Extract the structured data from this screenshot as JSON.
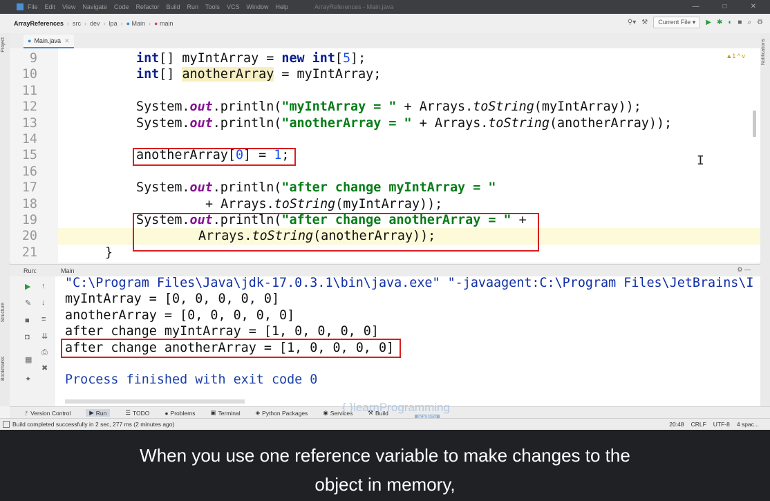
{
  "menu": {
    "items": [
      "File",
      "Edit",
      "View",
      "Navigate",
      "Code",
      "Refactor",
      "Build",
      "Run",
      "Tools",
      "VCS",
      "Window",
      "Help"
    ],
    "window_title": "ArrayReferences - Main.java"
  },
  "breadcrumb": {
    "project": "ArrayReferences",
    "parts": [
      "src",
      "dev",
      "lpa",
      "Main",
      "main"
    ]
  },
  "toolbar": {
    "run_config": "Current File ▾"
  },
  "side_labels": {
    "project": "Project",
    "structure": "Structure",
    "bookmarks": "Bookmarks",
    "notifications": "Notifications"
  },
  "editor_tab": {
    "label": "Main.java"
  },
  "warning_indicator": "▲1 ^ v",
  "code": {
    "line_numbers": [
      "9",
      "10",
      "11",
      "12",
      "13",
      "14",
      "15",
      "16",
      "17",
      "18",
      "19",
      "20",
      "21"
    ],
    "l9": {
      "a": "int",
      "b": "[] myIntArray = ",
      "c": "new",
      "d": " ",
      "e": "int",
      "f": "[",
      "g": "5",
      "h": "];"
    },
    "l10": {
      "a": "int",
      "b": "[] ",
      "c": "anotherArray",
      "d": " = myIntArray;"
    },
    "l12": {
      "a": "System.",
      "b": "out",
      "c": ".println(",
      "d": "\"myIntArray = \"",
      "e": " + Arrays.",
      "f": "toString",
      "g": "(myIntArray));"
    },
    "l13": {
      "a": "System.",
      "b": "out",
      "c": ".println(",
      "d": "\"anotherArray = \"",
      "e": " + Arrays.",
      "f": "toString",
      "g": "(anotherArray));"
    },
    "l15": {
      "a": "anotherArray[",
      "b": "0",
      "c": "] = ",
      "d": "1",
      "e": ";"
    },
    "l17": {
      "a": "System.",
      "b": "out",
      "c": ".println(",
      "d": "\"after change myIntArray = \""
    },
    "l18": {
      "a": "+ Arrays.",
      "b": "toString",
      "c": "(myIntArray));"
    },
    "l19": {
      "a": "System.",
      "b": "out",
      "c": ".println(",
      "d": "\"after change anotherArray = \"",
      "e": " +"
    },
    "l20": {
      "a": "Arrays.",
      "b": "toString",
      "c": "(anotherArray));"
    },
    "l21": {
      "a": "}"
    }
  },
  "run_panel": {
    "label": "Run:",
    "tab": "Main"
  },
  "console": {
    "cmd": "\"C:\\Program Files\\Java\\jdk-17.0.3.1\\bin\\java.exe\" \"-javaagent:C:\\Program Files\\JetBrains\\I",
    "out1": "myIntArray = [0, 0, 0, 0, 0]",
    "out2": "anotherArray = [0, 0, 0, 0, 0]",
    "out3": "after change myIntArray = [1, 0, 0, 0, 0]",
    "out4": "after change anotherArray = [1, 0, 0, 0, 0]",
    "done": "Process finished with exit code 0"
  },
  "bottom_tabs": [
    "Version Control",
    "Run",
    "TODO",
    "Problems",
    "Terminal",
    "Python Packages",
    "Services",
    "Build"
  ],
  "watermark": {
    "text": "{ }learnProgramming",
    "sub": "academy"
  },
  "status": {
    "message": "Build completed successfully in 2 sec, 277 ms (2 minutes ago)",
    "pos": "20:48",
    "eol": "CRLF",
    "enc": "UTF-8",
    "indent": "4 spac..."
  },
  "caption": {
    "line1": "When you use one reference variable to make changes to the",
    "line2": "object in memory,"
  }
}
